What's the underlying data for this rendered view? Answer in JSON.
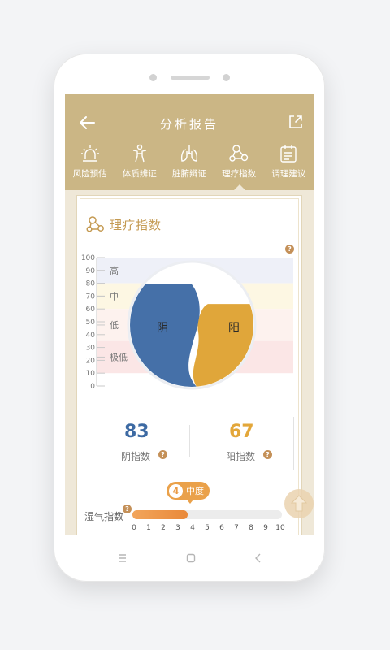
{
  "appbar": {
    "title": "分析报告",
    "back_icon": "arrow-left-icon",
    "share_icon": "share-icon",
    "background": "#cbb685"
  },
  "tabs": [
    {
      "label": "风险预估",
      "icon": "alarm-light-icon",
      "active": false
    },
    {
      "label": "体质辨证",
      "icon": "body-icon",
      "active": false
    },
    {
      "label": "脏腑辨证",
      "icon": "lungs-icon",
      "active": false
    },
    {
      "label": "理疗指数",
      "icon": "molecule-icon",
      "active": true
    },
    {
      "label": "调理建议",
      "icon": "clipboard-icon",
      "active": false
    }
  ],
  "section": {
    "title": "理疗指数",
    "icon": "molecule-icon",
    "accent": "#c49a52"
  },
  "chart_data": {
    "type": "pie",
    "axis": {
      "range": [
        0,
        100
      ],
      "ticks": [
        0,
        10,
        20,
        30,
        40,
        50,
        60,
        70,
        80,
        90,
        100
      ]
    },
    "bands": [
      {
        "label": "高",
        "from": 80,
        "to": 100,
        "color": "#eef0f8"
      },
      {
        "label": "中",
        "from": 60,
        "to": 80,
        "color": "#fdf7e3"
      },
      {
        "label": "低",
        "from": 35,
        "to": 60,
        "color": "#fdf2ee"
      },
      {
        "label": "极低",
        "from": 10,
        "to": 35,
        "color": "#fbe6e6"
      }
    ],
    "slices": [
      {
        "name": "阴",
        "value": 83,
        "color": "#4570a8"
      },
      {
        "name": "阳",
        "value": 67,
        "color": "#e0a63a"
      }
    ]
  },
  "scores": {
    "yin": {
      "value": "83",
      "label": "阴指数",
      "color": "#3d6aa3"
    },
    "yang": {
      "value": "67",
      "label": "阳指数",
      "color": "#e3a73a"
    }
  },
  "dampness": {
    "label": "湿气指数",
    "value": 4,
    "max": 10,
    "level_value": "4",
    "level_text": "中度",
    "scale": [
      "0",
      "1",
      "2",
      "3",
      "4",
      "5",
      "6",
      "7",
      "8",
      "9",
      "10"
    ]
  },
  "help_mark": "?",
  "fab_icon": "arrow-up-icon",
  "system_nav": [
    "menu-icon",
    "home-icon",
    "back-icon"
  ]
}
